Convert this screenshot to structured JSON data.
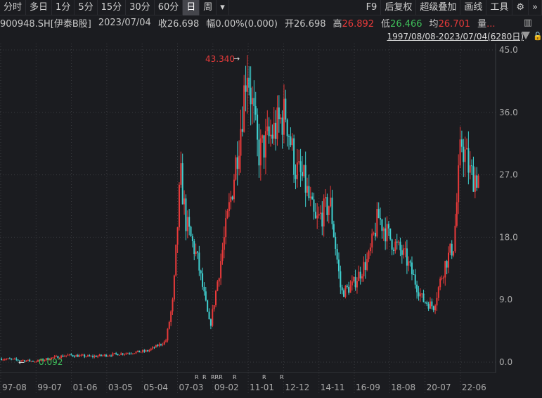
{
  "toolbar": {
    "periods": [
      "分时",
      "多日",
      "1分",
      "5分",
      "15分",
      "30分",
      "60分",
      "日",
      "周"
    ],
    "active": "日",
    "right": [
      "F9",
      "后复权",
      "超级叠加",
      "画线",
      "工具"
    ]
  },
  "info": {
    "code": "900948.SH[伊泰B股]",
    "date": "2023/07/04",
    "close_label": "收",
    "close": "26.698",
    "change_label": "幅",
    "change": "0.00%(0.000)",
    "open_label": "开",
    "open": "26.698",
    "high_label": "高",
    "high": "26.892",
    "low_label": "低",
    "low": "26.466",
    "avg_label": "均",
    "avg": "26.701",
    "vol_label": "量",
    "vol": "..."
  },
  "range": "1997/08/08-2023/07/04(6280日)",
  "colors": {
    "up": "#e83a3a",
    "down": "#3fd0d0",
    "grid": "#3a3b40"
  },
  "chart_data": {
    "type": "candlestick",
    "y_ticks": [
      "45.0",
      "36.0",
      "27.0",
      "18.0",
      "9.0",
      "0.0"
    ],
    "ylim": [
      0,
      45
    ],
    "x_ticks": [
      "97-08",
      "99-07",
      "01-06",
      "03-05",
      "05-04",
      "07-03",
      "09-02",
      "11-01",
      "12-12",
      "14-11",
      "16-09",
      "18-08",
      "20-07",
      "22-06"
    ],
    "max_label": "43.340",
    "min_label": "0.092",
    "r_markers": [
      "R",
      "R",
      "RRR",
      "R",
      "R",
      "R"
    ],
    "path": [
      [
        1997.6,
        0.5
      ],
      [
        1998.5,
        0.3
      ],
      [
        1999.5,
        0.09
      ],
      [
        2000.3,
        0.6
      ],
      [
        2001.2,
        1.0
      ],
      [
        2002.5,
        0.8
      ],
      [
        2004,
        1.2
      ],
      [
        2005.5,
        1.6
      ],
      [
        2006.5,
        3
      ],
      [
        2006.9,
        9
      ],
      [
        2007.3,
        27
      ],
      [
        2007.6,
        20
      ],
      [
        2008.2,
        15
      ],
      [
        2008.9,
        5
      ],
      [
        2009.5,
        15
      ],
      [
        2010.1,
        25
      ],
      [
        2010.6,
        35
      ],
      [
        2010.9,
        43.34
      ],
      [
        2011.5,
        30
      ],
      [
        2012.3,
        33
      ],
      [
        2013.0,
        36
      ],
      [
        2013.5,
        28
      ],
      [
        2014.0,
        26
      ],
      [
        2014.6,
        20
      ],
      [
        2015.4,
        23
      ],
      [
        2016.0,
        10
      ],
      [
        2016.6,
        11
      ],
      [
        2017.5,
        15
      ],
      [
        2018.0,
        21
      ],
      [
        2018.6,
        18
      ],
      [
        2019.5,
        15
      ],
      [
        2020.4,
        9
      ],
      [
        2021.0,
        8
      ],
      [
        2021.6,
        14
      ],
      [
        2022.1,
        17
      ],
      [
        2022.5,
        32
      ],
      [
        2023.0,
        27
      ],
      [
        2023.5,
        26.7
      ]
    ]
  }
}
